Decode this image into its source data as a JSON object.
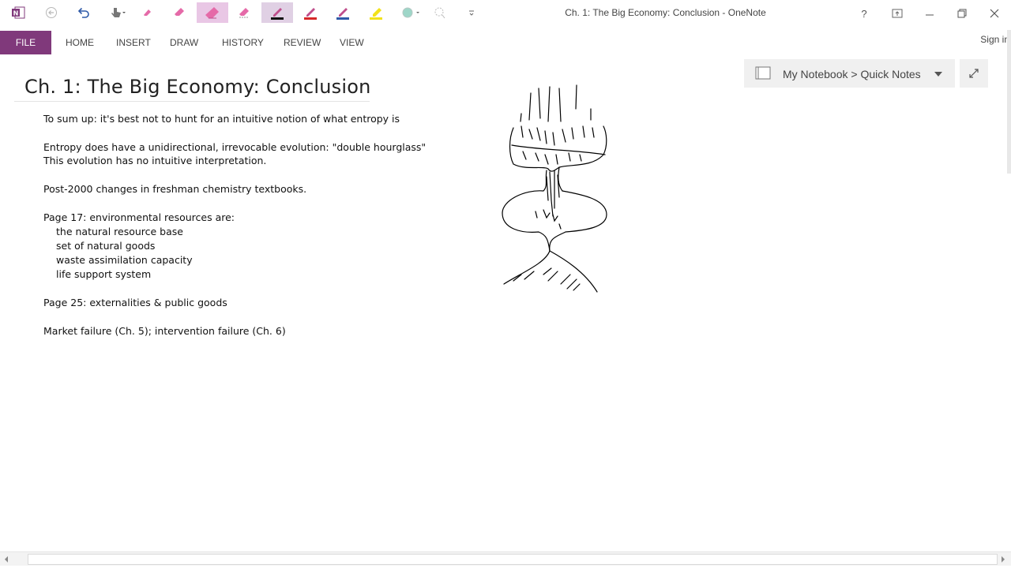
{
  "window": {
    "title": "Ch. 1: The Big Economy: Conclusion - OneNote",
    "controls": [
      "?",
      "ribbon-display",
      "minimize",
      "restore",
      "close"
    ]
  },
  "qat": {
    "icons": [
      "onenote-logo-icon",
      "back-icon",
      "undo-icon",
      "touch-mode-icon",
      "eraser-small-icon",
      "eraser-medium-icon",
      "eraser-large-icon",
      "eraser-stroke-icon",
      "pen-black-icon",
      "pen-red-icon",
      "pen-blue-icon",
      "highlighter-yellow-icon",
      "color-picker-icon",
      "lasso-icon",
      "customize-qat-icon"
    ],
    "colors": {
      "pink": "#e56aa8",
      "black": "#111111",
      "red": "#d62828",
      "blue": "#2f5aa8",
      "yellow": "#f2e21a",
      "teal": "#9ed6c8"
    }
  },
  "ribbon": {
    "file_label": "FILE",
    "tabs": [
      "HOME",
      "INSERT",
      "DRAW",
      "HISTORY",
      "REVIEW",
      "VIEW"
    ],
    "signin_label": "Sign in",
    "accent": "#80397b"
  },
  "notebook": {
    "path_label": "My Notebook > Quick Notes"
  },
  "page": {
    "title": "Ch. 1: The Big Economy: Conclusion",
    "lines": [
      "To sum up: it's best not to hunt for an intuitive notion of what entropy is",
      "Entropy does have a unidirectional, irrevocable evolution: \"double hourglass\"",
      "This evolution has no intuitive interpretation.",
      "Post-2000 changes in freshman chemistry textbooks.",
      "Page 17: environmental resources are:",
      "the natural resource base",
      "set of natural goods",
      "waste assimilation capacity",
      "life support system",
      "Page 25: externalities & public goods",
      "Market failure (Ch. 5); intervention failure (Ch. 6)"
    ]
  }
}
